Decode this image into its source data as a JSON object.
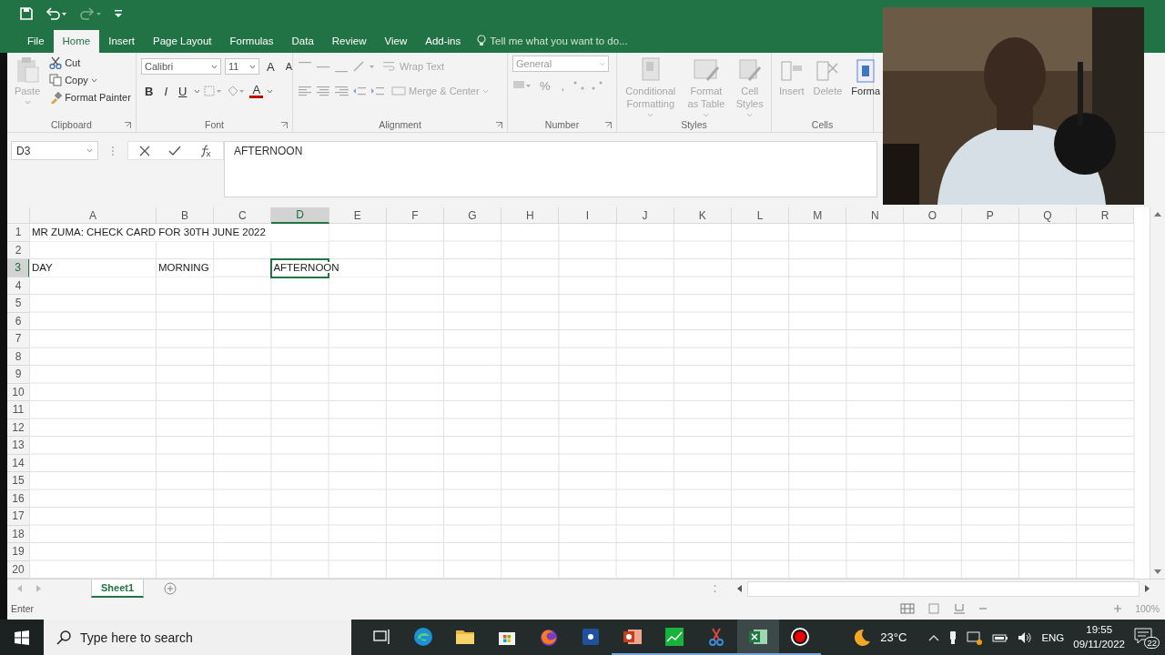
{
  "quick_access": [
    {
      "kind": "save",
      "disabled": false
    },
    {
      "kind": "undo",
      "disabled": false
    },
    {
      "kind": "redo",
      "disabled": true
    },
    {
      "kind": "customize",
      "disabled": false
    }
  ],
  "ribbon_tabs": [
    {
      "label": "File",
      "selected": false
    },
    {
      "label": "Home",
      "selected": true
    },
    {
      "label": "Insert",
      "selected": false
    },
    {
      "label": "Page Layout",
      "selected": false
    },
    {
      "label": "Formulas",
      "selected": false
    },
    {
      "label": "Data",
      "selected": false
    },
    {
      "label": "Review",
      "selected": false
    },
    {
      "label": "View",
      "selected": false
    },
    {
      "label": "Add-ins",
      "selected": false
    }
  ],
  "tell_me": {
    "placeholder": "Tell me what you want to do..."
  },
  "ribbon_groups": [
    {
      "kind": "clipboard",
      "label": "Clipboard",
      "commands": [
        {
          "label": "Paste",
          "disabled": true
        },
        {
          "label": "Cut",
          "disabled": false
        },
        {
          "label": "Copy",
          "disabled": false
        },
        {
          "label": "Format Painter",
          "disabled": false
        }
      ]
    },
    {
      "kind": "font",
      "label": "Font",
      "font_name": "Calibri",
      "font_size": "11",
      "size_buttons": [
        "A",
        "A"
      ],
      "style_buttons": [
        "B",
        "I",
        "U"
      ],
      "color_button": "A"
    },
    {
      "kind": "alignment",
      "label": "Alignment",
      "commands": [
        {
          "label": "Wrap Text",
          "disabled": true
        },
        {
          "label": "Merge & Center",
          "disabled": true
        }
      ]
    },
    {
      "kind": "number",
      "label": "Number",
      "format": "General",
      "symbols": [
        "%",
        ","
      ]
    },
    {
      "kind": "styles",
      "label": "Styles",
      "commands": [
        {
          "label": "Conditional Formatting",
          "disabled": true
        },
        {
          "label": "Format as Table",
          "disabled": true
        },
        {
          "label": "Cell Styles",
          "disabled": true
        }
      ]
    },
    {
      "kind": "cells",
      "label": "Cells",
      "commands": [
        {
          "label": "Insert",
          "disabled": true
        },
        {
          "label": "Delete",
          "disabled": true
        },
        {
          "label": "Forma",
          "disabled": false
        }
      ]
    }
  ],
  "formula_bar": {
    "name_box": "D3",
    "formula": "AFTERNOON"
  },
  "sheet": {
    "columns": [
      {
        "label": "A",
        "selected": false
      },
      {
        "label": "B",
        "selected": false
      },
      {
        "label": "C",
        "selected": false
      },
      {
        "label": "D",
        "selected": true
      },
      {
        "label": "E",
        "selected": false
      },
      {
        "label": "F",
        "selected": false
      },
      {
        "label": "G",
        "selected": false
      },
      {
        "label": "H",
        "selected": false
      },
      {
        "label": "I",
        "selected": false
      },
      {
        "label": "J",
        "selected": false
      },
      {
        "label": "K",
        "selected": false
      },
      {
        "label": "L",
        "selected": false
      },
      {
        "label": "M",
        "selected": false
      },
      {
        "label": "N",
        "selected": false
      },
      {
        "label": "O",
        "selected": false
      },
      {
        "label": "P",
        "selected": false
      },
      {
        "label": "Q",
        "selected": false
      },
      {
        "label": "R",
        "selected": false
      }
    ],
    "rows": [
      {
        "label": "1",
        "selected": false,
        "cells": [
          {
            "text": "MR ZUMA: CHECK CARD FOR 30TH JUNE 2022"
          }
        ]
      },
      {
        "label": "2",
        "selected": false
      },
      {
        "label": "3",
        "selected": true,
        "cells": [
          {
            "text": "DAY"
          },
          {
            "text": "MORNING"
          },
          {},
          {
            "text": "AFTERNOON"
          }
        ]
      },
      {
        "label": "4",
        "selected": false
      },
      {
        "label": "5",
        "selected": false
      },
      {
        "label": "6",
        "selected": false
      },
      {
        "label": "7",
        "selected": false
      },
      {
        "label": "8",
        "selected": false
      },
      {
        "label": "9",
        "selected": false
      },
      {
        "label": "10",
        "selected": false
      },
      {
        "label": "11",
        "selected": false
      },
      {
        "label": "12",
        "selected": false
      },
      {
        "label": "13",
        "selected": false
      },
      {
        "label": "14",
        "selected": false
      },
      {
        "label": "15",
        "selected": false
      },
      {
        "label": "16",
        "selected": false
      },
      {
        "label": "17",
        "selected": false
      },
      {
        "label": "18",
        "selected": false
      },
      {
        "label": "19",
        "selected": false
      },
      {
        "label": "20",
        "selected": false
      }
    ]
  },
  "sheet_tabs": [
    {
      "label": "Sheet1",
      "selected": true
    }
  ],
  "status_bar": {
    "mode": "Enter",
    "zoom": "100%"
  },
  "taskbar": {
    "search_placeholder": "Type here to search",
    "apps": [
      {
        "kind": "task_view",
        "running": false,
        "active": false
      },
      {
        "kind": "browser",
        "running": false,
        "active": false
      },
      {
        "kind": "folder",
        "running": false,
        "active": false
      },
      {
        "kind": "store",
        "running": false,
        "active": false
      },
      {
        "kind": "fox",
        "running": false,
        "active": false
      },
      {
        "kind": "b_app",
        "running": false,
        "active": false
      },
      {
        "kind": "presentation",
        "running": true,
        "active": false
      },
      {
        "kind": "chart",
        "running": true,
        "active": false
      },
      {
        "kind": "scissors",
        "running": true,
        "active": false
      },
      {
        "kind": "spreadsheet",
        "running": true,
        "active": true
      },
      {
        "kind": "record",
        "running": true,
        "active": false
      }
    ],
    "weather": "23°C",
    "language": "ENG",
    "time": "19:55",
    "date": "09/11/2022",
    "notifications": "22"
  }
}
